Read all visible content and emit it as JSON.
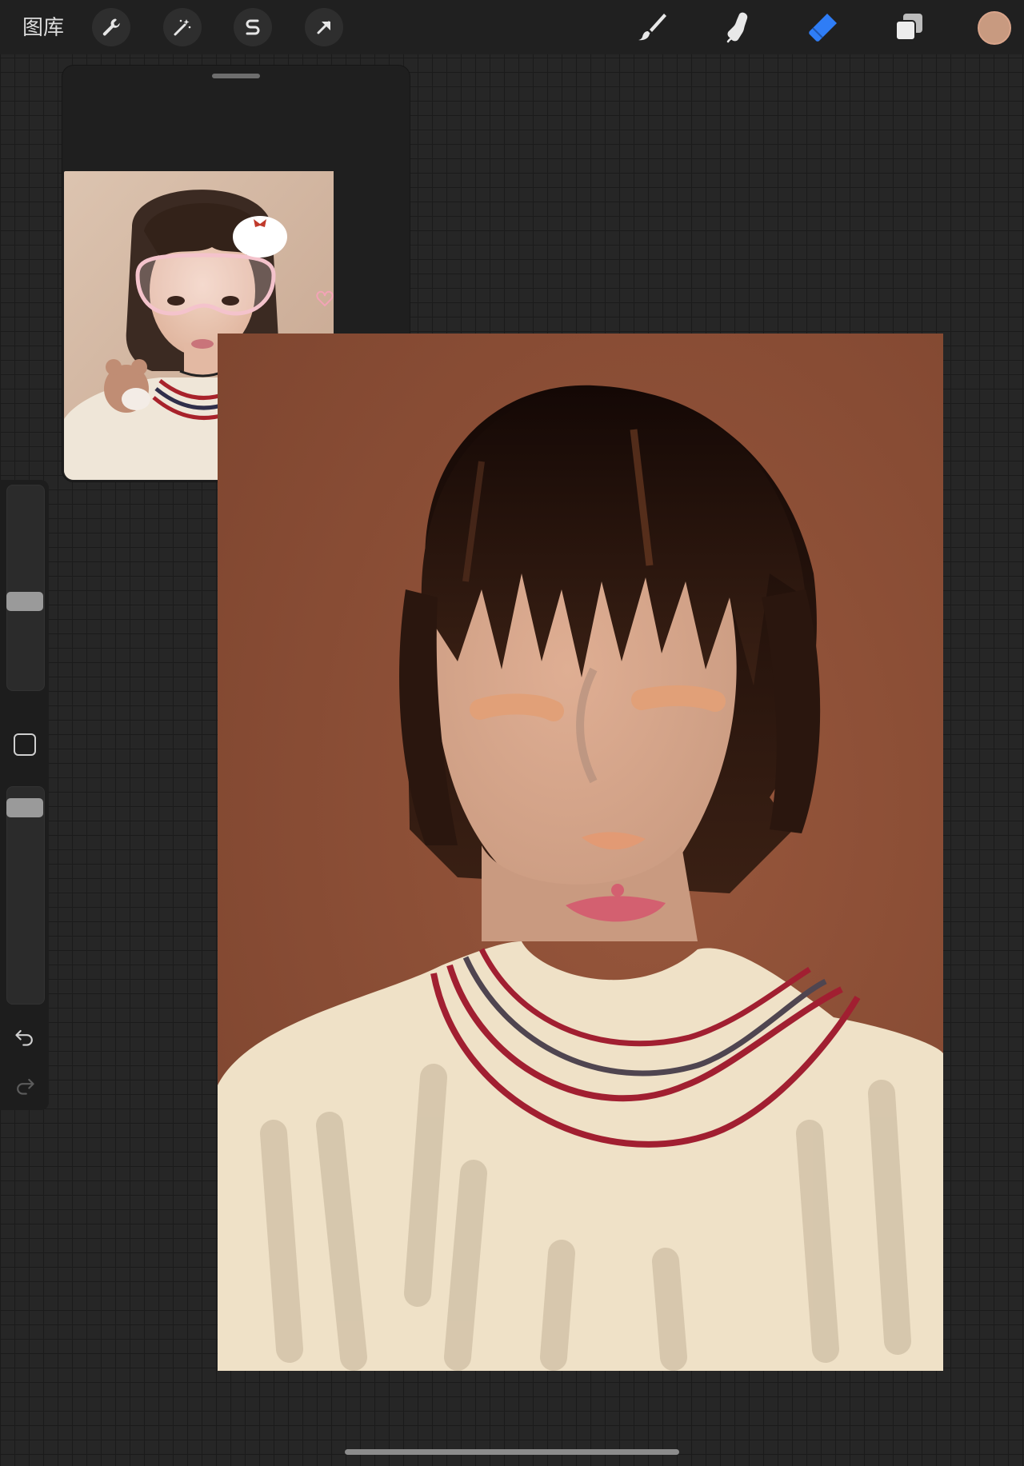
{
  "toolbar": {
    "gallery_label": "图库",
    "actions": [
      {
        "name": "actions",
        "icon": "wrench-icon"
      },
      {
        "name": "adjustments",
        "icon": "magic-wand-icon"
      },
      {
        "name": "selection",
        "icon": "selection-s-icon"
      },
      {
        "name": "transform",
        "icon": "arrow-cursor-icon"
      }
    ],
    "tools": [
      {
        "name": "brush",
        "icon": "paintbrush-icon",
        "active": false
      },
      {
        "name": "smudge",
        "icon": "smudge-finger-icon",
        "active": false
      },
      {
        "name": "eraser",
        "icon": "eraser-icon",
        "active": true
      },
      {
        "name": "layers",
        "icon": "layers-icon",
        "active": false
      }
    ],
    "current_color": "#c89a80",
    "accent_color": "#2f7df6"
  },
  "reference": {
    "title": "",
    "image": "reference-photo"
  },
  "sidebar": {
    "brush_size": 0.52,
    "opacity": 0.0,
    "icons": [
      "modify-square-icon",
      "undo-icon",
      "redo-icon"
    ]
  },
  "canvas": {
    "background_color": "#8b4f36",
    "sweater_color": "#efe1c7"
  }
}
